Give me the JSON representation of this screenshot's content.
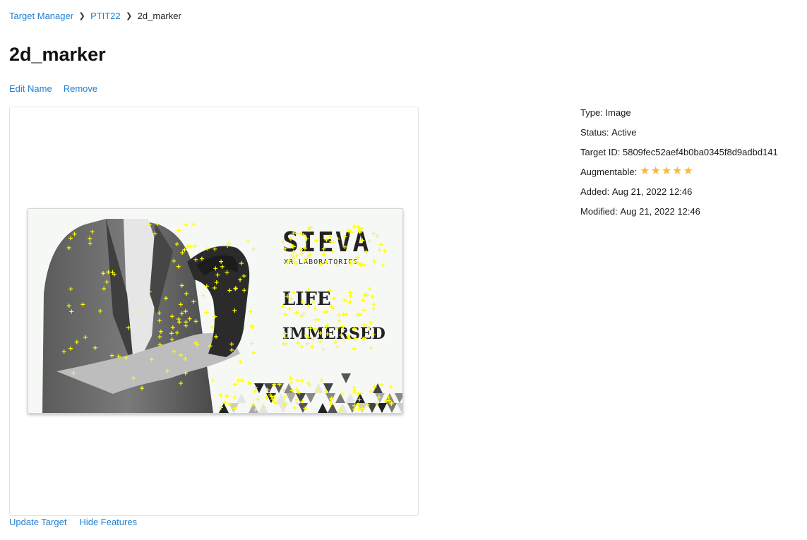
{
  "breadcrumb": {
    "items": [
      "Target Manager",
      "PTIT22"
    ],
    "current": "2d_marker"
  },
  "page": {
    "title": "2d_marker"
  },
  "actions": {
    "edit_name": "Edit Name",
    "remove": "Remove",
    "update_target": "Update Target",
    "hide_features": "Hide Features"
  },
  "image": {
    "brand_text": "SIEVA",
    "tagline_text": "XR LABORATORIES",
    "headline_line1": "LIFE",
    "headline_line2": "IMMERSED",
    "feature_color": "#ffff00"
  },
  "details": {
    "type_label": "Type:",
    "type_value": "Image",
    "status_label": "Status:",
    "status_value": "Active",
    "target_id_label": "Target ID:",
    "target_id_value": "5809fec52aef4b0ba0345f8d9adbd141",
    "augmentable_label": "Augmentable:",
    "augmentable_rating": 5,
    "star_color": "#f5b942",
    "added_label": "Added:",
    "added_value": "Aug 21, 2022 12:46",
    "modified_label": "Modified:",
    "modified_value": "Aug 21, 2022 12:46"
  }
}
